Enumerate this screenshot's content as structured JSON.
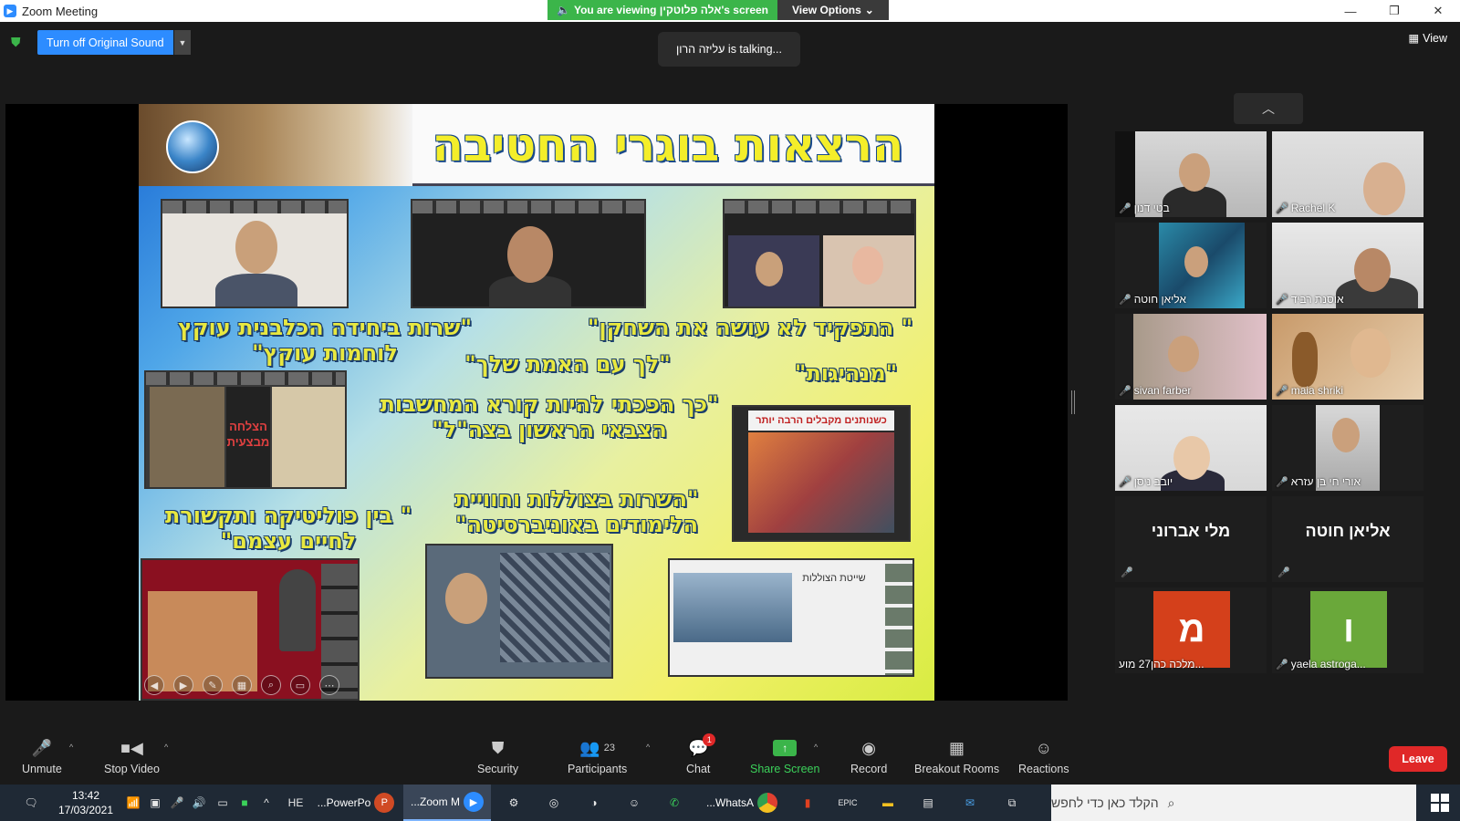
{
  "window": {
    "title": "Zoom Meeting"
  },
  "banner": {
    "viewing_text": "You are viewing אלה פלוטקין's screen",
    "view_options_label": "View Options"
  },
  "window_controls": {
    "minimize": "—",
    "restore": "❐",
    "close": "✕"
  },
  "top": {
    "original_sound_label": "Turn off Original Sound",
    "talking_text": "עליזה הרון is talking...",
    "view_label": "View"
  },
  "slide": {
    "title": "הרצאות בוגרי החטיבה",
    "quotes": [
      "\"שרות ביחידה הכלבנית עוקץ לוחמות עוקץ\"",
      "\" התפקיד לא עושה את השחקן\"",
      "\"לך עם האמת שלך\"",
      "\"מנהיגות\"",
      "\"כך הפכתי להיות קורא המחשבות הצבאי הראשון בצה\"ל\"",
      "\" בין פוליטיקה ותקשורת לחיים עצמם\"",
      "\"השרות בצוללות וחוויית הלימודים באוניברסיטה\""
    ],
    "inset_labels": {
      "success": "הצלחה מבצעית",
      "receive": "כשנותנים מקבלים הרבה יותר",
      "flotilla": "שייטת הצוללות"
    }
  },
  "gallery": {
    "participants": [
      {
        "name": "בטי דנון",
        "type": "video"
      },
      {
        "name": "Rachel K",
        "type": "video"
      },
      {
        "name": "אליאן חוטה",
        "type": "video"
      },
      {
        "name": "אוסנת רביד",
        "type": "video"
      },
      {
        "name": "sivan farber",
        "type": "video"
      },
      {
        "name": "maia shriki",
        "type": "video"
      },
      {
        "name": "יובב ניסן",
        "type": "video"
      },
      {
        "name": "אורי חי בן עזרא",
        "type": "video"
      },
      {
        "name": "מלי אברוני",
        "type": "name-only"
      },
      {
        "name": "אליאן חוטה",
        "type": "name-only"
      },
      {
        "name": "מלכה כהן27 מוע...",
        "type": "avatar",
        "initial": "מ",
        "color": "#d4401b"
      },
      {
        "name": "yaela astroga...",
        "type": "avatar",
        "initial": "ו",
        "color": "#6aa83a"
      }
    ]
  },
  "toolbar": {
    "unmute": "Unmute",
    "stop_video": "Stop Video",
    "security": "Security",
    "participants": "Participants",
    "participants_count": "23",
    "chat": "Chat",
    "chat_badge": "1",
    "share_screen": "Share Screen",
    "record": "Record",
    "breakout_rooms": "Breakout Rooms",
    "reactions": "Reactions",
    "leave": "Leave"
  },
  "taskbar": {
    "time": "13:42",
    "date": "17/03/2021",
    "lang": "HE",
    "powerpoint": "...PowerPo",
    "zoom": "...Zoom M",
    "whatsapp": "...WhatsA",
    "search_placeholder": "הקלד כאן כדי לחפש"
  }
}
